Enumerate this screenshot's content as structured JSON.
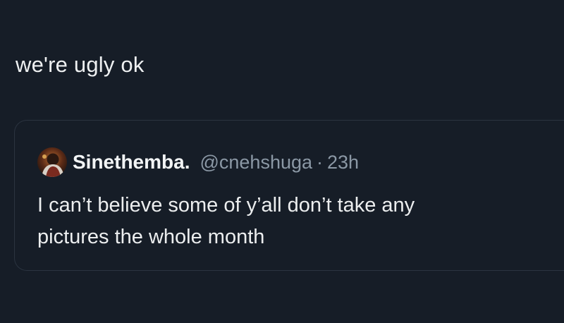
{
  "tweet": {
    "text": "we're ugly ok"
  },
  "quoted_tweet": {
    "display_name": "Sinethemba.",
    "handle": "@cnehshuga",
    "separator": "·",
    "time": "23h",
    "text_lines": [
      "I can’t believe some of y’all don’t take any",
      "pictures the whole month"
    ]
  },
  "colors": {
    "background": "#161d27",
    "text": "#e7e9ea",
    "secondary_text": "#8b98a5",
    "card_border": "#2b3440"
  },
  "icons": {
    "avatar": "user-avatar-photo"
  }
}
